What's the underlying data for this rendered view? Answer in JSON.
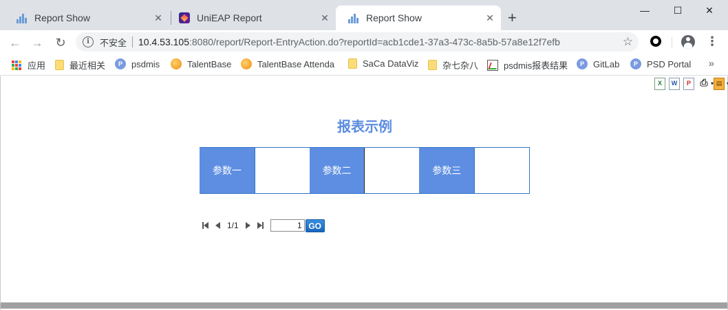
{
  "browser": {
    "tabs": [
      {
        "label": "Report Show",
        "active": false
      },
      {
        "label": "UniEAP Report",
        "active": false
      },
      {
        "label": "Report Show",
        "active": true
      }
    ],
    "tab_close_glyph": "✕",
    "new_tab_glyph": "+",
    "window_controls": {
      "minimize": "—",
      "maximize": "☐",
      "close": "✕"
    },
    "nav": {
      "back": "←",
      "forward": "→",
      "reload": "↻"
    },
    "address": {
      "security_label": "不安全",
      "host": "10.4.53.105",
      "path": ":8080/report/Report-EntryAction.do?reportId=acb1cde1-37a3-473c-8a5b-57a8e12f7efb"
    },
    "bookmark_star": "☆",
    "menu_glyph": "⋮",
    "bookmarks": [
      {
        "label": "应用",
        "icon": "apps-icon"
      },
      {
        "label": "最近相关",
        "icon": "folder-icon"
      },
      {
        "label": "psdmis",
        "icon": "psd-icon"
      },
      {
        "label": "TalentBase",
        "icon": "talentbase-icon"
      },
      {
        "label": "TalentBase Attenda",
        "icon": "talentbase-icon"
      },
      {
        "label": "SaCa DataViz",
        "icon": "folder-icon"
      },
      {
        "label": "杂七杂八",
        "icon": "folder-icon"
      },
      {
        "label": "psdmis报表结果",
        "icon": "chart-icon"
      },
      {
        "label": "GitLab",
        "icon": "psd-icon"
      },
      {
        "label": "PSD Portal",
        "icon": "psd-icon"
      }
    ],
    "bookmarks_more": "»"
  },
  "report": {
    "tools": {
      "excel": "X",
      "word": "W",
      "pdf": "P",
      "print": "⎙",
      "export": "▤"
    },
    "title": "报表示例",
    "params": [
      {
        "label": "参数一",
        "value": ""
      },
      {
        "label": "参数二",
        "value": ""
      },
      {
        "label": "参数三",
        "value": ""
      }
    ],
    "pager": {
      "page_info": "1/1",
      "page_input": "1",
      "go_label": "GO"
    }
  },
  "colors": {
    "title": "#5b8be0",
    "param_label_bg": "#5e8ee2",
    "table_border": "#2e73c7",
    "go_button": "#1f73c9"
  }
}
